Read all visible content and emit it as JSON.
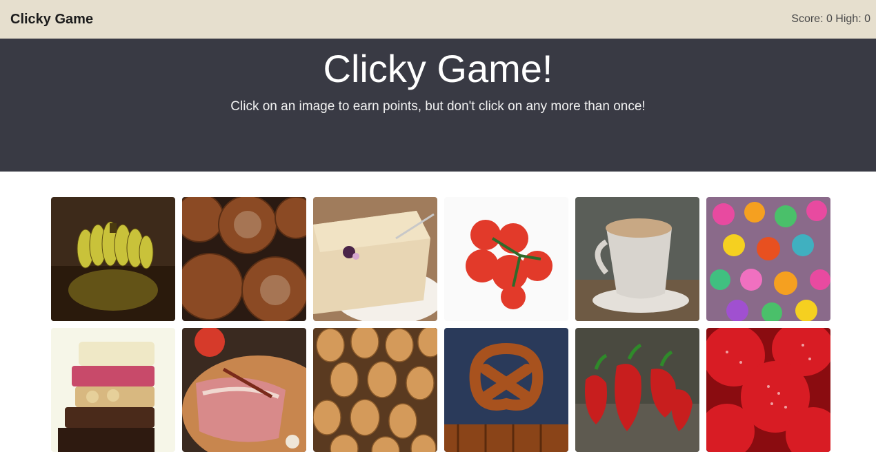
{
  "navbar": {
    "brand": "Clicky Game",
    "score_text": "Score: 0 High: 0"
  },
  "header": {
    "title": "Clicky Game!",
    "subtitle": "Click on an image to earn points, but don't click on any more than once!"
  },
  "tiles": [
    {
      "subject": "bananas"
    },
    {
      "subject": "bread loaves"
    },
    {
      "subject": "cheesecake"
    },
    {
      "subject": "tomatoes"
    },
    {
      "subject": "cappuccino"
    },
    {
      "subject": "candies"
    },
    {
      "subject": "chocolate stack"
    },
    {
      "subject": "raw meat"
    },
    {
      "subject": "onions"
    },
    {
      "subject": "pretzels"
    },
    {
      "subject": "red peppers"
    },
    {
      "subject": "strawberries"
    }
  ]
}
